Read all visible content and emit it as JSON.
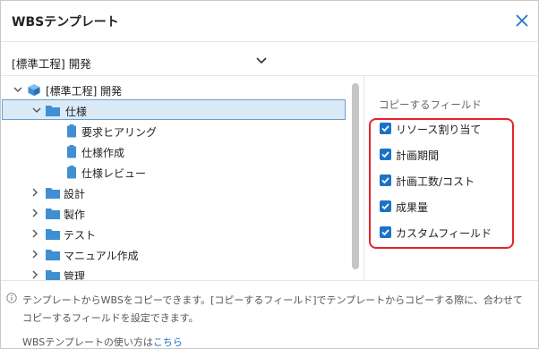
{
  "dialog": {
    "title": "WBSテンプレート",
    "close_icon": "close-icon"
  },
  "template_select": {
    "value": "[標準工程] 開発"
  },
  "tree": {
    "root": {
      "label": "[標準工程] 開発",
      "icon": "cube-icon",
      "expanded": true
    },
    "items": [
      {
        "label": "仕様",
        "icon": "folder-icon",
        "expanded": true,
        "selected": true
      },
      {
        "label": "要求ヒアリング",
        "icon": "clipboard-icon"
      },
      {
        "label": "仕様作成",
        "icon": "clipboard-icon"
      },
      {
        "label": "仕様レビュー",
        "icon": "clipboard-icon"
      },
      {
        "label": "設計",
        "icon": "folder-icon",
        "expanded": false
      },
      {
        "label": "製作",
        "icon": "folder-icon",
        "expanded": false
      },
      {
        "label": "テスト",
        "icon": "folder-icon",
        "expanded": false
      },
      {
        "label": "マニュアル作成",
        "icon": "folder-icon",
        "expanded": false
      },
      {
        "label": "管理",
        "icon": "folder-icon",
        "expanded": false
      }
    ]
  },
  "copy_fields": {
    "title": "コピーするフィールド",
    "items": [
      {
        "label": "リソース割り当て",
        "checked": true
      },
      {
        "label": "計画期間",
        "checked": true
      },
      {
        "label": "計画工数/コスト",
        "checked": true
      },
      {
        "label": "成果量",
        "checked": true
      },
      {
        "label": "カスタムフィールド",
        "checked": true
      }
    ],
    "highlight_color": "#e4232c"
  },
  "footer": {
    "info": "テンプレートからWBSをコピーできます。[コピーするフィールド]でテンプレートからコピーする際に、合わせてコピーするフィールドを設定できます。",
    "help_prefix": "WBSテンプレートの使い方は",
    "help_link": "こちら"
  },
  "colors": {
    "accent": "#1a73c7",
    "folder": "#3f8fd2",
    "selected_bg": "#dbeaf7",
    "selected_border": "#6a9fce"
  }
}
